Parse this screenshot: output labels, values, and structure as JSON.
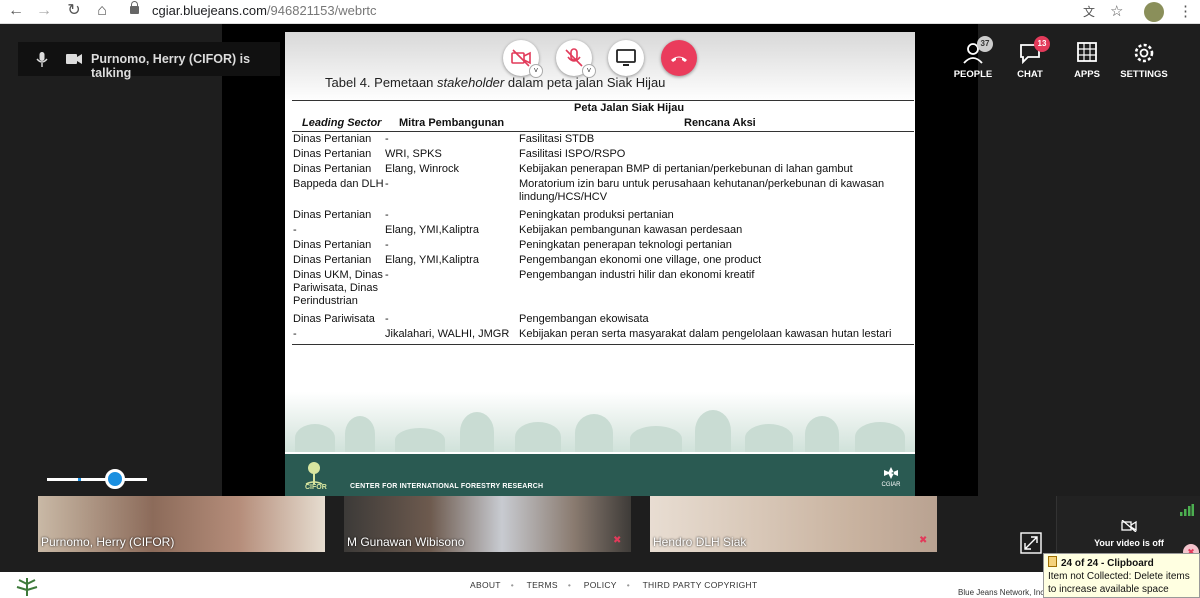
{
  "browser": {
    "url_host": "cgiar.bluejeans.com",
    "url_path": "/946821153/webrtc"
  },
  "meeting": {
    "talking_indicator": "Purnomo, Herry (CIFOR) is talking",
    "tools": [
      {
        "label": "PEOPLE",
        "badge": "37",
        "icon": "people-icon"
      },
      {
        "label": "CHAT",
        "badge": "13",
        "icon": "chat-icon"
      },
      {
        "label": "APPS",
        "icon": "apps-icon"
      },
      {
        "label": "SETTINGS",
        "icon": "settings-icon"
      }
    ],
    "controls": [
      "video-off-button",
      "mic-muted-button",
      "screen-share-button",
      "hang-up-button"
    ],
    "volume_level": 0.68
  },
  "slide": {
    "title_prefix": "Tabel 4. Pemetaan ",
    "title_italic": "stakeholder",
    "title_suffix": " dalam peta jalan Siak Hijau",
    "table_group_header": "Peta Jalan Siak Hijau",
    "columns": [
      "Leading Sector",
      "Mitra Pembangunan",
      "Rencana Aksi"
    ],
    "rows": [
      [
        "Dinas Pertanian",
        "-",
        "Fasilitasi STDB"
      ],
      [
        "Dinas Pertanian",
        "WRI, SPKS",
        "Fasilitasi ISPO/RSPO"
      ],
      [
        "Dinas Pertanian",
        "Elang, Winrock",
        "Kebijakan penerapan BMP di pertanian/perkebunan di lahan gambut"
      ],
      [
        "Bappeda dan DLH",
        "-",
        "Moratorium izin baru untuk perusahaan kehutanan/perkebunan di kawasan lindung/HCS/HCV"
      ],
      [
        "Dinas Pertanian",
        "-",
        "Peningkatan produksi pertanian"
      ],
      [
        "-",
        "Elang, YMI,Kaliptra",
        "Kebijakan pembangunan kawasan perdesaan"
      ],
      [
        "Dinas Pertanian",
        "-",
        "Peningkatan penerapan teknologi pertanian"
      ],
      [
        "Dinas Pertanian",
        "Elang, YMI,Kaliptra",
        "Pengembangan ekonomi one village, one product"
      ],
      [
        "Dinas UKM, Dinas Pariwisata, Dinas Perindustrian",
        "-",
        "Pengembangan industri hilir dan ekonomi kreatif"
      ],
      [
        "Dinas Pariwisata",
        "-",
        "Pengembangan ekowisata"
      ],
      [
        "-",
        "Jikalahari, WALHI, JMGR",
        "Kebijakan peran serta masyarakat dalam pengelolaan kawasan hutan lestari"
      ]
    ],
    "footer_org": "CENTER FOR INTERNATIONAL FORESTRY RESEARCH",
    "footer_logo_text": "CIFOR",
    "footer_logo_right": "CGIAR"
  },
  "participants": [
    {
      "name": "Purnomo, Herry  (CIFOR)",
      "muted": false
    },
    {
      "name": "M Gunawan Wibisono",
      "muted": true
    },
    {
      "name": "Hendro DLH Siak",
      "muted": true
    }
  ],
  "self_view": {
    "text": "Your video is off"
  },
  "footer": {
    "links": [
      "ABOUT",
      "TERMS",
      "POLICY",
      "THIRD PARTY COPYRIGHT"
    ],
    "brand": "Blue Jeans Network, Inc"
  },
  "clipboard_toast": {
    "title": "24 of 24 - Clipboard",
    "message": "Item not Collected: Delete items to increase available space"
  }
}
